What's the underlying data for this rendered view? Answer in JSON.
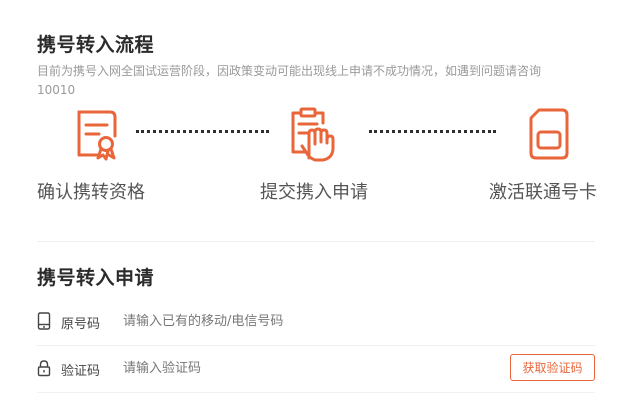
{
  "flow": {
    "title": "携号转入流程",
    "notice": "目前为携号入网全国试运营阶段，因政策变动可能出现线上申请不成功情况，如遇到问题请咨询10010",
    "steps": [
      {
        "label": "确认携转资格",
        "icon": "certificate-icon"
      },
      {
        "label": "提交携入申请",
        "icon": "hand-clipboard-icon"
      },
      {
        "label": "激活联通号卡",
        "icon": "sim-card-icon"
      }
    ]
  },
  "apply": {
    "title": "携号转入申请",
    "phone": {
      "label": "原号码",
      "placeholder": "请输入已有的移动/电信号码",
      "icon": "phone-icon"
    },
    "code": {
      "label": "验证码",
      "placeholder": "请输入验证码",
      "icon": "lock-icon",
      "button_label": "获取验证码"
    }
  },
  "colors": {
    "accent": "#e9663a",
    "text": "#333333",
    "muted": "#9a9a9a"
  }
}
